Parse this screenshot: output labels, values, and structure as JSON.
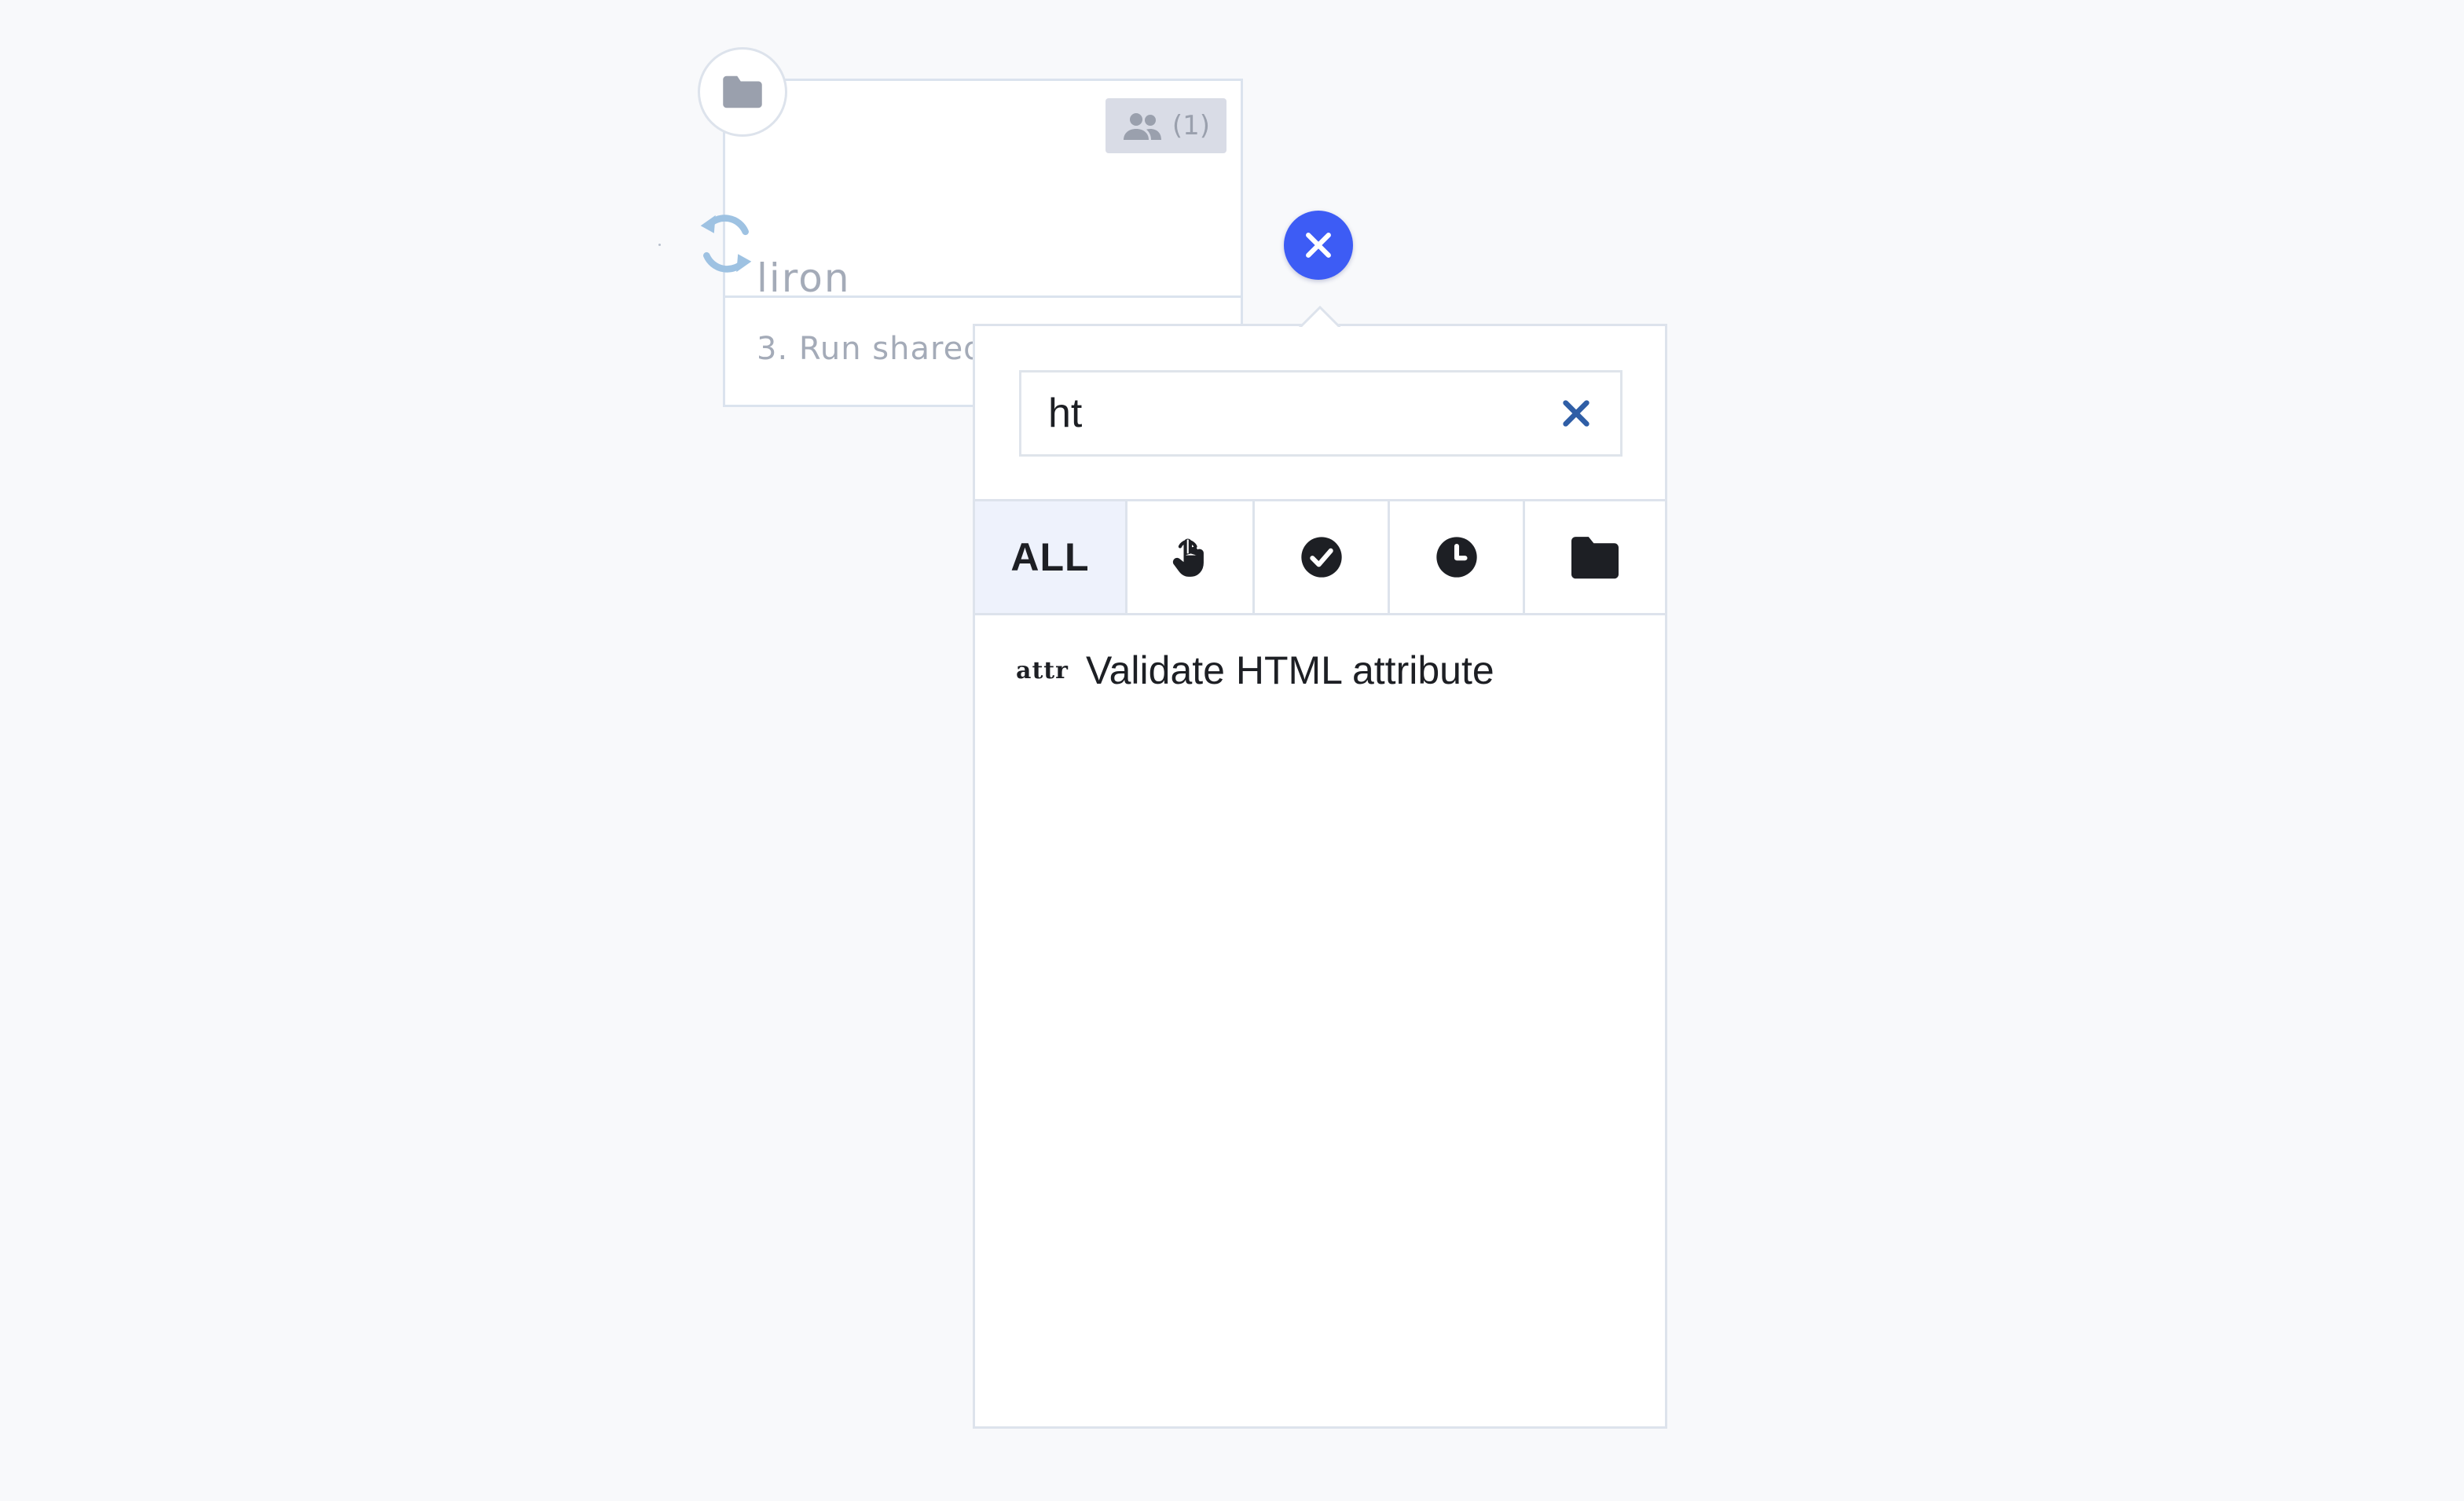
{
  "card": {
    "title": "liron",
    "step": "3. Run shared",
    "shared_count": "(1)"
  },
  "search": {
    "value": "ht",
    "placeholder": ""
  },
  "filters": [
    {
      "label": "ALL",
      "icon": "",
      "active": true
    },
    {
      "label": "",
      "icon": "pointer-hand-icon",
      "active": false
    },
    {
      "label": "",
      "icon": "check-circle-icon",
      "active": false
    },
    {
      "label": "",
      "icon": "clock-icon",
      "active": false
    },
    {
      "label": "",
      "icon": "folder-icon",
      "active": false
    }
  ],
  "results": [
    {
      "tag": "attr",
      "label": "Validate HTML attribute"
    }
  ],
  "colors": {
    "accent": "#3d5cf5",
    "clear_icon": "#2f5ea6",
    "active_tab": "#eef2fc",
    "muted_text": "#a4abb8",
    "border": "#dde3ec"
  }
}
